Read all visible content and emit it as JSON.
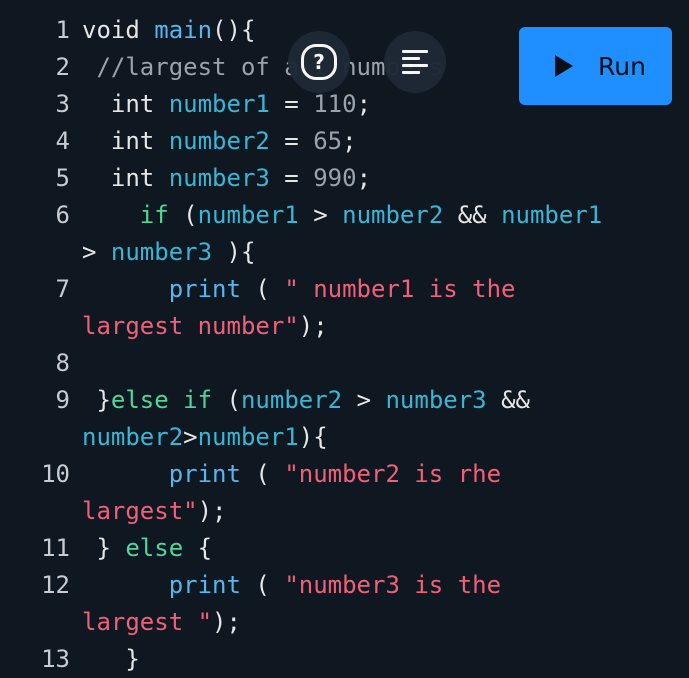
{
  "toolbar": {
    "help_icon_glyph": "?",
    "run_label": "Run"
  },
  "editor": {
    "lines": [
      {
        "n": "1",
        "tokens": [
          {
            "t": "void ",
            "c": "plain"
          },
          {
            "t": "main",
            "c": "fn"
          },
          {
            "t": "(){",
            "c": "plain"
          }
        ]
      },
      {
        "n": "2",
        "tokens": [
          {
            "t": " //largest of all numbers",
            "c": "cmt"
          }
        ]
      },
      {
        "n": "3",
        "tokens": [
          {
            "t": "  int ",
            "c": "plain"
          },
          {
            "t": "number1",
            "c": "id"
          },
          {
            "t": " = ",
            "c": "op"
          },
          {
            "t": "110",
            "c": "num"
          },
          {
            "t": ";",
            "c": "plain"
          }
        ]
      },
      {
        "n": "4",
        "tokens": [
          {
            "t": "  int ",
            "c": "plain"
          },
          {
            "t": "number2",
            "c": "id"
          },
          {
            "t": " = ",
            "c": "op"
          },
          {
            "t": "65",
            "c": "num"
          },
          {
            "t": ";",
            "c": "plain"
          }
        ]
      },
      {
        "n": "5",
        "tokens": [
          {
            "t": "  int ",
            "c": "plain"
          },
          {
            "t": "number3",
            "c": "id"
          },
          {
            "t": " = ",
            "c": "op"
          },
          {
            "t": "990",
            "c": "num"
          },
          {
            "t": ";",
            "c": "plain"
          }
        ]
      },
      {
        "n": "6",
        "tokens": [
          {
            "t": "    if",
            "c": "ctl"
          },
          {
            "t": " (",
            "c": "plain"
          },
          {
            "t": "number1",
            "c": "id"
          },
          {
            "t": " > ",
            "c": "op"
          },
          {
            "t": "number2",
            "c": "id"
          },
          {
            "t": " && ",
            "c": "op"
          },
          {
            "t": "number1",
            "c": "id"
          }
        ]
      },
      {
        "n": "",
        "tokens": [
          {
            "t": "> ",
            "c": "op"
          },
          {
            "t": "number3",
            "c": "id"
          },
          {
            "t": " ){",
            "c": "plain"
          }
        ]
      },
      {
        "n": "7",
        "tokens": [
          {
            "t": "      ",
            "c": "plain"
          },
          {
            "t": "print",
            "c": "fn"
          },
          {
            "t": " ( ",
            "c": "plain"
          },
          {
            "t": "\" number1 is the",
            "c": "str"
          }
        ]
      },
      {
        "n": "",
        "tokens": [
          {
            "t": "largest number\"",
            "c": "str"
          },
          {
            "t": ");",
            "c": "plain"
          }
        ]
      },
      {
        "n": "8",
        "tokens": []
      },
      {
        "n": "9",
        "tokens": [
          {
            "t": " }",
            "c": "plain"
          },
          {
            "t": "else if",
            "c": "ctl"
          },
          {
            "t": " (",
            "c": "plain"
          },
          {
            "t": "number2",
            "c": "id"
          },
          {
            "t": " > ",
            "c": "op"
          },
          {
            "t": "number3",
            "c": "id"
          },
          {
            "t": " &&",
            "c": "op"
          }
        ]
      },
      {
        "n": "",
        "tokens": [
          {
            "t": "number2",
            "c": "id"
          },
          {
            "t": ">",
            "c": "op"
          },
          {
            "t": "number1",
            "c": "id"
          },
          {
            "t": "){",
            "c": "plain"
          }
        ]
      },
      {
        "n": "10",
        "tokens": [
          {
            "t": "      ",
            "c": "plain"
          },
          {
            "t": "print",
            "c": "fn"
          },
          {
            "t": " ( ",
            "c": "plain"
          },
          {
            "t": "\"number2 is rhe",
            "c": "str"
          }
        ]
      },
      {
        "n": "",
        "tokens": [
          {
            "t": "largest\"",
            "c": "str"
          },
          {
            "t": ");",
            "c": "plain"
          }
        ]
      },
      {
        "n": "11",
        "tokens": [
          {
            "t": " } ",
            "c": "plain"
          },
          {
            "t": "else",
            "c": "ctl"
          },
          {
            "t": " {",
            "c": "plain"
          }
        ]
      },
      {
        "n": "12",
        "tokens": [
          {
            "t": "      ",
            "c": "plain"
          },
          {
            "t": "print",
            "c": "fn"
          },
          {
            "t": " ( ",
            "c": "plain"
          },
          {
            "t": "\"number3 is the",
            "c": "str"
          }
        ]
      },
      {
        "n": "",
        "tokens": [
          {
            "t": "largest \"",
            "c": "str"
          },
          {
            "t": ");",
            "c": "plain"
          }
        ]
      },
      {
        "n": "13",
        "tokens": [
          {
            "t": "   }",
            "c": "plain"
          }
        ]
      }
    ]
  },
  "colors": {
    "background": "#0f1720",
    "run_button": "#1f8fff",
    "fab": "#1e2935",
    "identifier": "#38b6d6",
    "keyword_control": "#4fd69a",
    "string": "#f1607a",
    "number": "#9aa2ad"
  }
}
